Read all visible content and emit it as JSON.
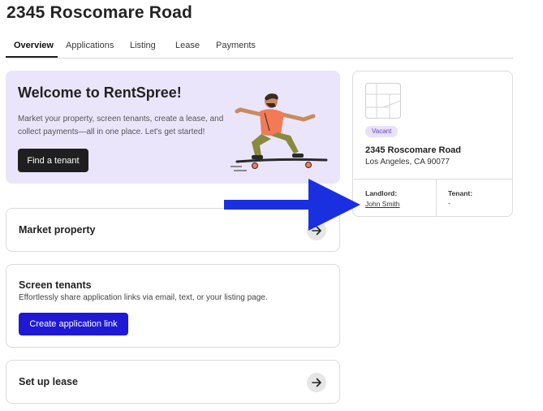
{
  "page": {
    "title": "2345 Roscomare Road"
  },
  "tabs": [
    {
      "label": "Overview",
      "active": true
    },
    {
      "label": "Applications",
      "active": false
    },
    {
      "label": "Listing",
      "active": false
    },
    {
      "label": "Lease",
      "active": false
    },
    {
      "label": "Payments",
      "active": false
    }
  ],
  "welcome": {
    "title": "Welcome to RentSpree!",
    "text": "Market your property, screen tenants, create a lease, and collect payments—all in one place. Let's get started!",
    "button_label": "Find a tenant"
  },
  "cards": {
    "market": {
      "title": "Market property",
      "icon": "arrow-right-icon"
    },
    "screen": {
      "title": "Screen tenants",
      "subtitle": "Effortlessly share application links via email, text, or your listing page.",
      "button_label": "Create application link"
    },
    "lease": {
      "title": "Set up lease",
      "icon": "arrow-right-icon"
    }
  },
  "property": {
    "status": "Vacant",
    "street": "2345 Roscomare Road",
    "city": "Los Angeles, CA 90077",
    "landlord_label": "Landlord:",
    "landlord_name": "John Smith",
    "tenant_label": "Tenant:",
    "tenant_value": "-"
  },
  "colors": {
    "welcome_bg": "#ebe5fb",
    "primary_blue": "#1f19d6",
    "dark_button": "#1f1f1f",
    "badge_bg": "#e9e1fc",
    "badge_text": "#6a40c8",
    "annotation_arrow": "#1a2fe0"
  }
}
